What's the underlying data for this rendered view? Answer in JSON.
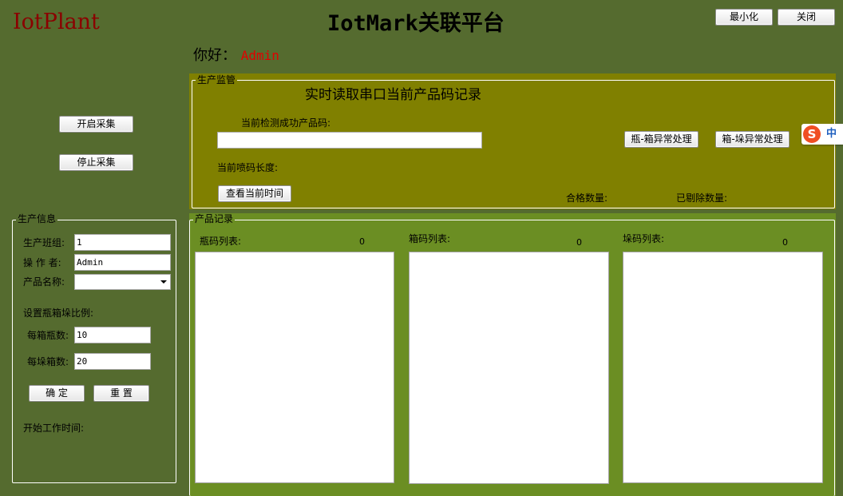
{
  "app": {
    "brand": "IotPlant",
    "title": "IotMark关联平台",
    "minimize_label": "最小化",
    "close_label": "关闭"
  },
  "greeting": {
    "prefix": "你好：",
    "user": "Admin"
  },
  "collect": {
    "start_label": "开启采集",
    "stop_label": "停止采集"
  },
  "monitor": {
    "legend": "生产监管",
    "heading": "实时读取串口当前产品码记录",
    "current_code_label": "当前检测成功产品码:",
    "current_code_value": "",
    "code_length_label": "当前喷码长度:",
    "check_time_label": "查看当前时间",
    "bottle_box_label": "瓶-箱异常处理",
    "box_stack_label": "箱-垛异常处理",
    "qualified_label": "合格数量:",
    "rejected_label": "已剔除数量:"
  },
  "info": {
    "legend": "生产信息",
    "team_label": "生产班组:",
    "team_value": "1",
    "operator_label": "操 作 者:",
    "operator_value": "Admin",
    "product_label": "产品名称:",
    "product_value": "",
    "ratio_label": "设置瓶箱垛比例:",
    "per_box_label": "每箱瓶数:",
    "per_box_value": "10",
    "per_stack_label": "每垛箱数:",
    "per_stack_value": "20",
    "confirm_label": "确 定",
    "reset_label": "重 置",
    "start_time_label": "开始工作时间:"
  },
  "records": {
    "legend": "产品记录",
    "bottle_label": "瓶码列表:",
    "bottle_count": "0",
    "box_label": "箱码列表:",
    "box_count": "0",
    "stack_label": "垛码列表:",
    "stack_count": "0"
  },
  "ime": {
    "logo": "S",
    "mode": "中"
  },
  "colors": {
    "background": "#556b2f",
    "monitor_panel": "#808000",
    "records_panel": "#6b8e23",
    "brand": "#8b0000",
    "user": "#e00000"
  }
}
